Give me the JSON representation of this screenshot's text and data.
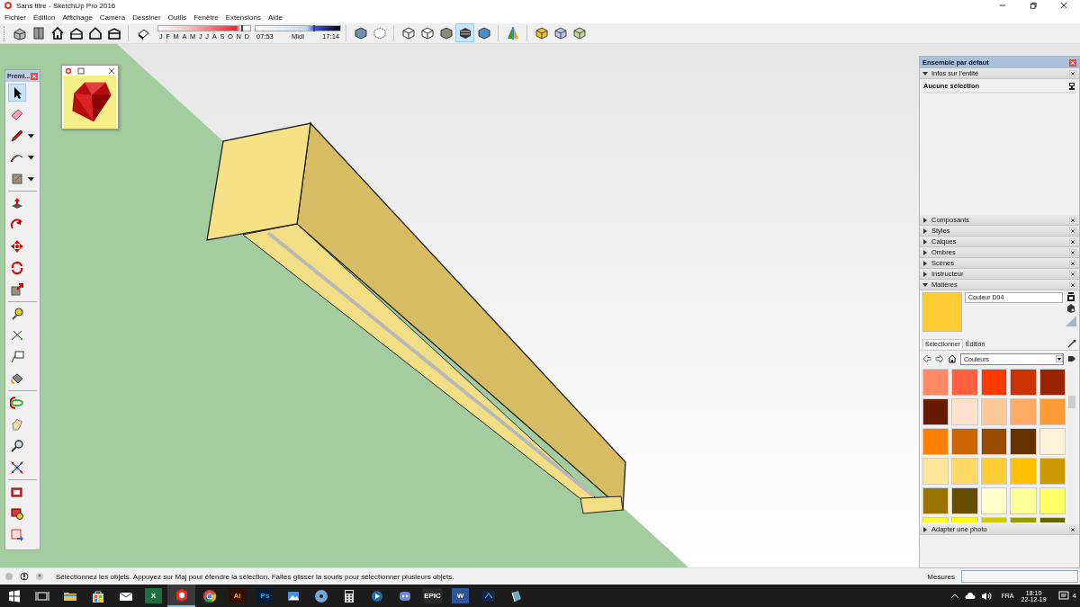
{
  "window": {
    "title": "Sans titre - SketchUp Pro 2016"
  },
  "menu": [
    "Fichier",
    "Édition",
    "Affichage",
    "Caméra",
    "Dessiner",
    "Outils",
    "Fenêtre",
    "Extensions",
    "Aide"
  ],
  "toolbar": {
    "buttons": [
      {
        "selected": false
      },
      {
        "selected": false
      },
      {
        "selected": false
      },
      {
        "selected": false
      },
      {
        "selected": false
      },
      {
        "selected": false
      },
      {
        "selected": false
      },
      {
        "selected": false
      },
      {
        "selected": false
      },
      {
        "selected": false
      },
      {
        "selected": false
      },
      {
        "selected": false
      },
      {
        "selected": true
      },
      {
        "selected": false
      },
      {
        "selected": false
      },
      {
        "selected": false
      },
      {
        "selected": false
      },
      {
        "selected": false
      }
    ],
    "date_slider": {
      "months": [
        "J",
        "F",
        "M",
        "A",
        "M",
        "J",
        "J",
        "A",
        "S",
        "O",
        "N",
        "D"
      ],
      "level": 0.9
    },
    "time_slider": {
      "start": "07:53",
      "middle": "Midi",
      "end": "17:14",
      "level": 0.68
    }
  },
  "tool_palette": {
    "title": "Premi...",
    "tools": [
      {
        "selected": true
      },
      {
        "selected": false
      },
      {
        "selected": false
      },
      {
        "selected": false
      },
      {
        "selected": false
      },
      {
        "selected": false
      },
      {
        "selected": false
      },
      {
        "selected": false
      },
      {
        "selected": false
      },
      {
        "selected": false
      },
      {
        "selected": false
      },
      {
        "selected": false
      },
      {
        "selected": false
      },
      {
        "selected": false
      },
      {
        "selected": false
      },
      {
        "selected": false
      },
      {
        "selected": false
      },
      {
        "selected": false
      },
      {
        "selected": false
      },
      {
        "selected": false
      },
      {
        "selected": false
      }
    ]
  },
  "tray": {
    "title": "Ensemble par défaut",
    "panels": [
      {
        "kind": "entity_info",
        "title": "Infos sur l'entité",
        "expanded": true,
        "selection": "Aucune sélection"
      },
      {
        "kind": "plain",
        "title": "Composants",
        "expanded": false
      },
      {
        "kind": "plain",
        "title": "Styles",
        "expanded": false
      },
      {
        "kind": "plain",
        "title": "Calques",
        "expanded": false
      },
      {
        "kind": "plain",
        "title": "Ombres",
        "expanded": false
      },
      {
        "kind": "plain",
        "title": "Scènes",
        "expanded": false
      },
      {
        "kind": "plain",
        "title": "Instructeur",
        "expanded": false
      },
      {
        "kind": "materials",
        "title": "Matières",
        "expanded": true,
        "material": {
          "name": "Couleur D04",
          "color": "#ffcc33"
        },
        "tabs": [
          {
            "label": "Sélectionner",
            "selected": true
          },
          {
            "label": "Édition",
            "selected": false
          }
        ],
        "library": "Couleurs",
        "colors": [
          {
            "color": "#ff8866"
          },
          {
            "color": "#ff6040"
          },
          {
            "color": "#ff3a00"
          },
          {
            "color": "#cc3300"
          },
          {
            "color": "#992200"
          },
          {
            "color": "#661a00"
          },
          {
            "color": "#ffe0cc"
          },
          {
            "color": "#ffc899"
          },
          {
            "color": "#ffaa66"
          },
          {
            "color": "#ff9933"
          },
          {
            "color": "#ff8000"
          },
          {
            "color": "#cc6600"
          },
          {
            "color": "#994c00"
          },
          {
            "color": "#663300"
          },
          {
            "color": "#fff2d9"
          },
          {
            "color": "#ffe699"
          },
          {
            "color": "#ffd966"
          },
          {
            "color": "#ffcc33"
          },
          {
            "color": "#ffc000"
          },
          {
            "color": "#cc9900"
          },
          {
            "color": "#997300"
          },
          {
            "color": "#664d00"
          },
          {
            "color": "#ffffcc"
          },
          {
            "color": "#ffff99"
          },
          {
            "color": "#ffff66"
          },
          {
            "color": "#ffff33"
          },
          {
            "color": "#ffff00"
          },
          {
            "color": "#cccc00"
          },
          {
            "color": "#999900"
          },
          {
            "color": "#666600"
          }
        ]
      },
      {
        "kind": "plain",
        "title": "Adapter une photo",
        "expanded": false
      }
    ]
  },
  "status_bar": {
    "message": "Sélectionnez les objets. Appuyez sur Maj pour étendre la sélection. Faites glisser la souris pour sélectionner plusieurs objets.",
    "measure_label": "Mesures"
  },
  "taskbar": {
    "apps": [
      {
        "kind": "start",
        "selected": false
      },
      {
        "kind": "taskview",
        "selected": false
      },
      {
        "kind": "explorer",
        "selected": false
      },
      {
        "kind": "store",
        "selected": false
      },
      {
        "kind": "mail",
        "selected": false
      },
      {
        "kind": "excel",
        "label": "X",
        "selected": false
      },
      {
        "kind": "sketchup",
        "selected": true
      },
      {
        "kind": "chrome",
        "selected": false
      },
      {
        "kind": "illustrator",
        "label": "Ai",
        "selected": false
      },
      {
        "kind": "photoshop",
        "label": "Ps",
        "selected": false
      },
      {
        "kind": "photos",
        "selected": false
      },
      {
        "kind": "disc",
        "selected": false
      },
      {
        "kind": "calculator",
        "selected": false
      },
      {
        "kind": "media",
        "selected": false
      },
      {
        "kind": "discord",
        "selected": false
      },
      {
        "kind": "epic",
        "label": "EPIC",
        "selected": false
      },
      {
        "kind": "word",
        "label": "W",
        "selected": false
      },
      {
        "kind": "network",
        "selected": false
      },
      {
        "kind": "book",
        "selected": false
      }
    ],
    "language": "FRA",
    "time": "18:10",
    "date": "22-12-19",
    "notifications": "4"
  }
}
